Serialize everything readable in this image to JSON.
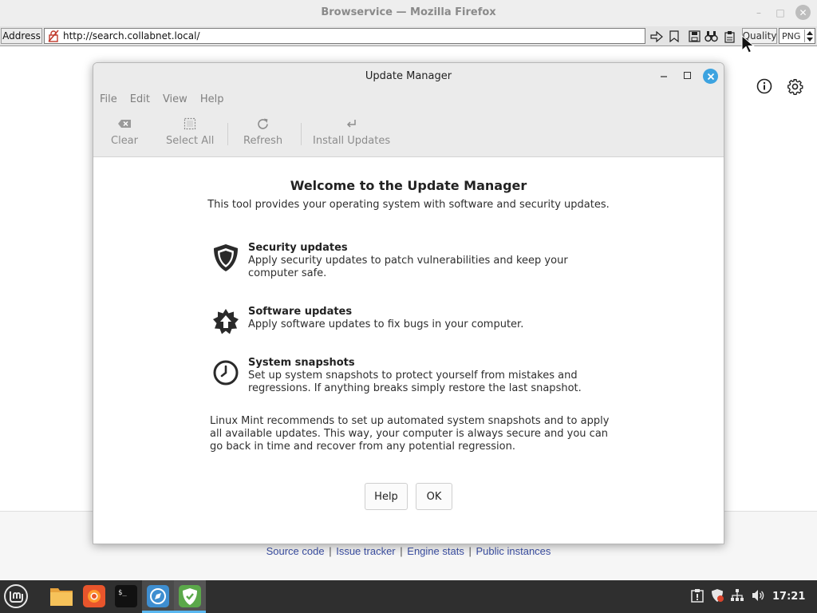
{
  "browser": {
    "title": "Browservice — Mozilla Firefox",
    "min_glyph": "–",
    "max_glyph": "□",
    "close_glyph": "✕",
    "address_label": "Address",
    "url": "http://search.collabnet.local/",
    "quality_label": "Quality",
    "format_value": "PNG"
  },
  "page": {
    "footer_links": [
      "Source code",
      "Issue tracker",
      "Engine stats",
      "Public instances"
    ],
    "footer_separator": "|"
  },
  "dialog": {
    "title": "Update Manager",
    "menu": [
      "File",
      "Edit",
      "View",
      "Help"
    ],
    "toolbar": {
      "clear": "Clear",
      "select_all": "Select All",
      "refresh": "Refresh",
      "install": "Install Updates"
    },
    "welcome_title": "Welcome to the Update Manager",
    "welcome_subtitle": "This tool provides your operating system with software and security updates.",
    "features": [
      {
        "title": "Security updates",
        "desc": "Apply security updates to patch vulnerabilities and keep your computer safe.",
        "icon": "shield-icon"
      },
      {
        "title": "Software updates",
        "desc": "Apply software updates to fix bugs in your computer.",
        "icon": "star-arrow-icon"
      },
      {
        "title": "System snapshots",
        "desc": "Set up system snapshots to protect yourself from mistakes and regressions. If anything breaks simply restore the last snapshot.",
        "icon": "clock-icon"
      }
    ],
    "recommendation": "Linux Mint recommends to set up automated system snapshots and to apply all available updates. This way, your computer is always secure and you can go back in time and recover from any potential regression.",
    "help_button": "Help",
    "ok_button": "OK",
    "accent_color": "#3ca3e0"
  },
  "taskbar": {
    "clock": "17:21",
    "apps": [
      "menu-icon",
      "files-icon",
      "firefox-icon",
      "terminal-icon",
      "web-browser-icon",
      "update-manager-icon"
    ],
    "underline_color": "#59b7f0"
  }
}
